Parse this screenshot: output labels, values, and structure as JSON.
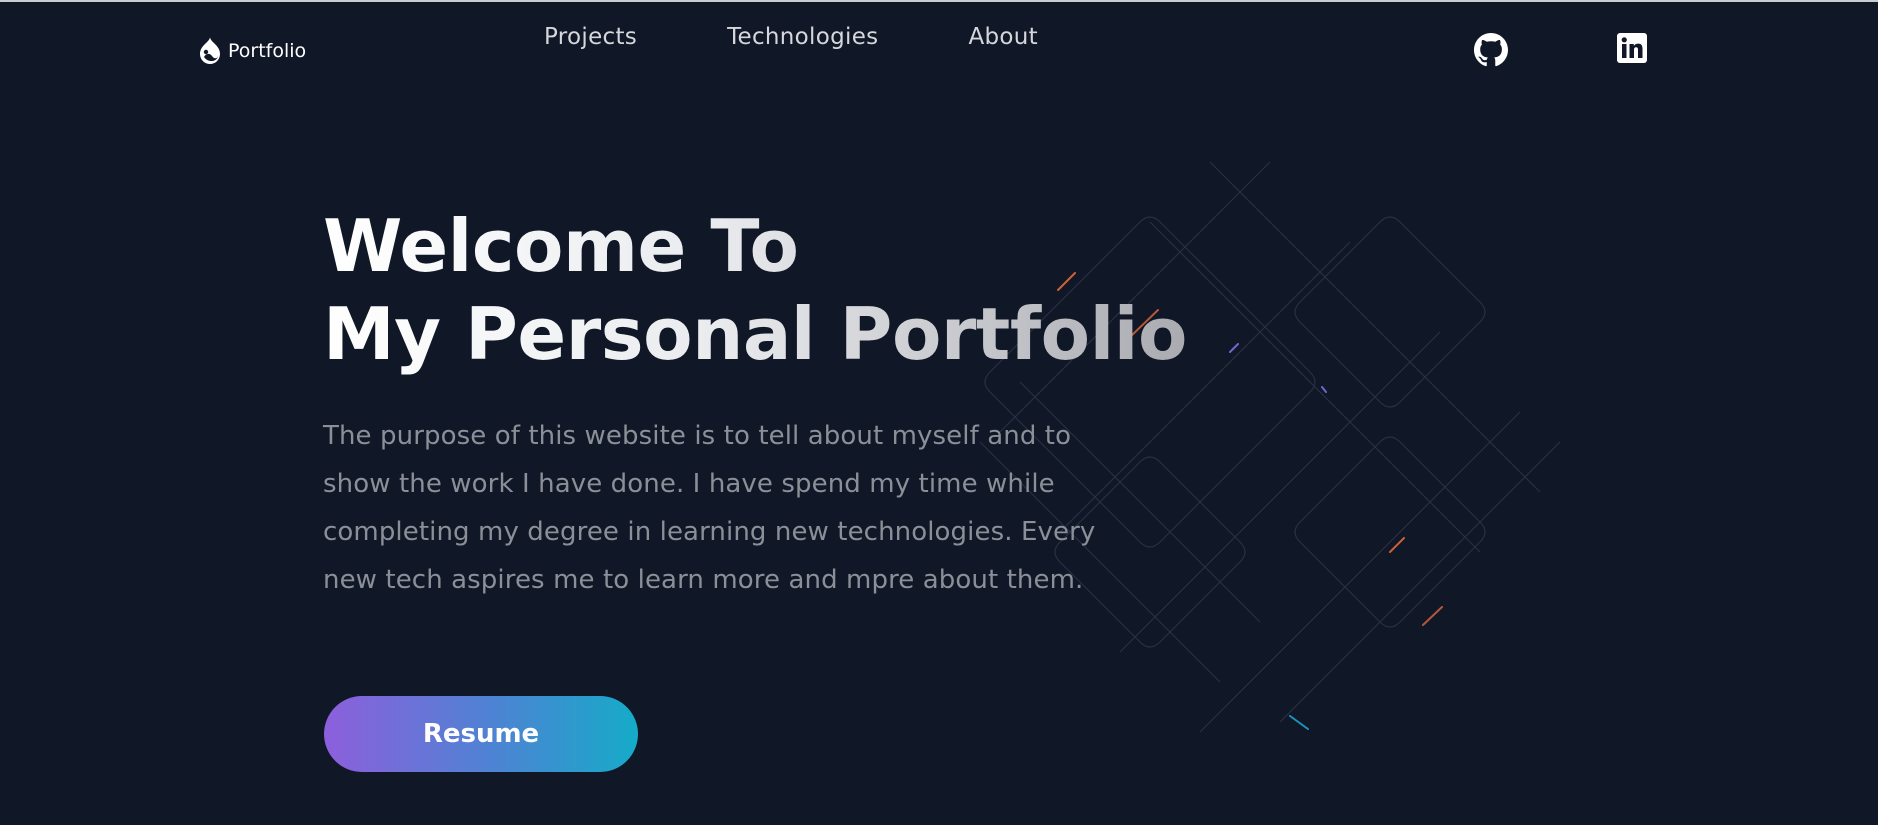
{
  "nav": {
    "logo_text": "Portfolio",
    "links": [
      "Projects",
      "Technologies",
      "About"
    ],
    "social": [
      "github-icon",
      "linkedin-icon"
    ]
  },
  "hero": {
    "title_line1": "Welcome To",
    "title_line2": "My Personal Portfolio",
    "description": "The purpose of this website is to tell about myself and to show the work I have done. I have spend my time while completing my degree in learning new technologies. Every new tech aspires me to learn more and mpre about them.",
    "resume_label": "Resume"
  },
  "colors": {
    "background": "#101726",
    "nav_text": "#d5d7dc",
    "description_text": "#8b8f98",
    "button_gradient_start": "#8d5fdc",
    "button_gradient_end": "#15abc8"
  }
}
